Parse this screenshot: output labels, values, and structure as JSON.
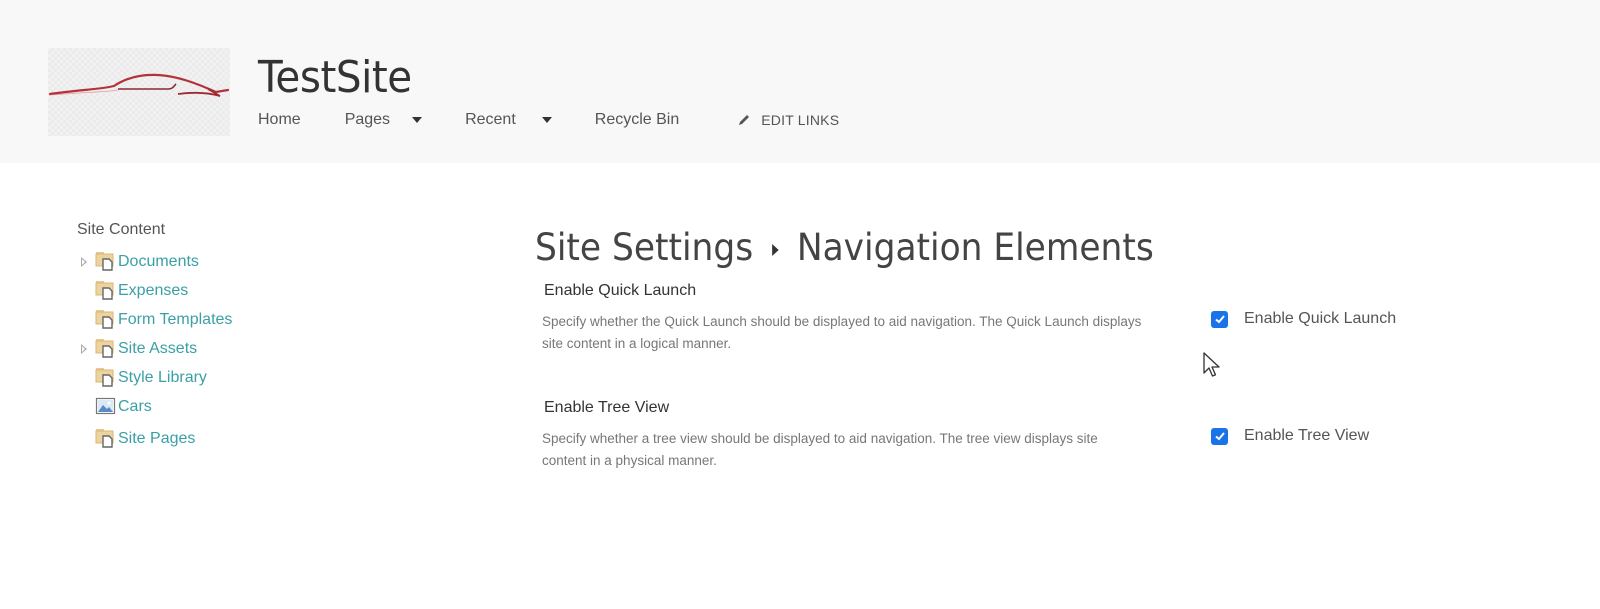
{
  "header": {
    "logo_alt": "car-silhouette-logo",
    "site_title": "TestSite",
    "nav": [
      {
        "label": "Home",
        "has_dropdown": false
      },
      {
        "label": "Pages",
        "has_dropdown": true
      },
      {
        "label": "Recent",
        "has_dropdown": true
      },
      {
        "label": "Recycle Bin",
        "has_dropdown": false
      }
    ],
    "edit_links_label": "EDIT LINKS"
  },
  "left_nav": {
    "heading": "Site Content",
    "items": [
      {
        "label": "Documents",
        "icon": "library-folder-icon",
        "expandable": true
      },
      {
        "label": "Expenses",
        "icon": "library-folder-icon",
        "expandable": false
      },
      {
        "label": "Form Templates",
        "icon": "library-folder-icon",
        "expandable": false
      },
      {
        "label": "Site Assets",
        "icon": "library-folder-icon",
        "expandable": true
      },
      {
        "label": "Style Library",
        "icon": "library-folder-icon",
        "expandable": false
      },
      {
        "label": "Cars",
        "icon": "picture-library-icon",
        "expandable": false
      },
      {
        "label": "Site Pages",
        "icon": "library-folder-icon",
        "expandable": false
      }
    ]
  },
  "main": {
    "breadcrumb_parent": "Site Settings",
    "breadcrumb_current": "Navigation Elements",
    "sections": [
      {
        "title": "Enable Quick Launch",
        "description": "Specify whether the Quick Launch should be displayed to aid navigation.  The Quick Launch displays site content in a logical manner.",
        "checkbox_label": "Enable Quick Launch",
        "checked": true
      },
      {
        "title": "Enable Tree View",
        "description": "Specify whether a tree view should be displayed to aid navigation.  The tree view displays site content in a physical manner.",
        "checkbox_label": "Enable Tree View",
        "checked": true
      }
    ]
  },
  "colors": {
    "header_bg": "#f8f8f8",
    "link_teal": "#3aa0a6",
    "checkbox_blue": "#1a73e8"
  }
}
